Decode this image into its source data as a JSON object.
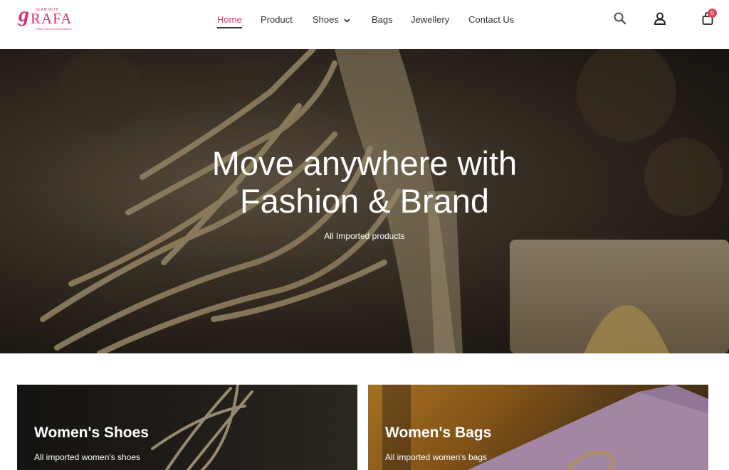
{
  "brand": {
    "logo_initial": "g",
    "logo_name": "RAFA",
    "logo_small": "GLAM WITH",
    "logo_tag": "Where luxury meets fashion"
  },
  "nav": {
    "items": [
      {
        "label": "Home",
        "active": true
      },
      {
        "label": "Product"
      },
      {
        "label": "Shoes",
        "has_dropdown": true
      },
      {
        "label": "Bags"
      },
      {
        "label": "Jewellery"
      },
      {
        "label": "Contact Us"
      }
    ]
  },
  "header_icons": {
    "search": "search-icon",
    "account": "user-icon",
    "cart": "cart-icon",
    "cart_count": "0"
  },
  "hero": {
    "title_line1": "Move anywhere with",
    "title_line2": "Fashion & Brand",
    "subtitle": "All Imported products"
  },
  "categories": [
    {
      "title": "Women's Shoes",
      "subtitle": "All imported women's shoes"
    },
    {
      "title": "Women's Bags",
      "subtitle": "All imported women's bags"
    }
  ],
  "colors": {
    "brand_pink": "#d6337a",
    "badge_red": "#e0465a",
    "text_dark": "#333333"
  }
}
